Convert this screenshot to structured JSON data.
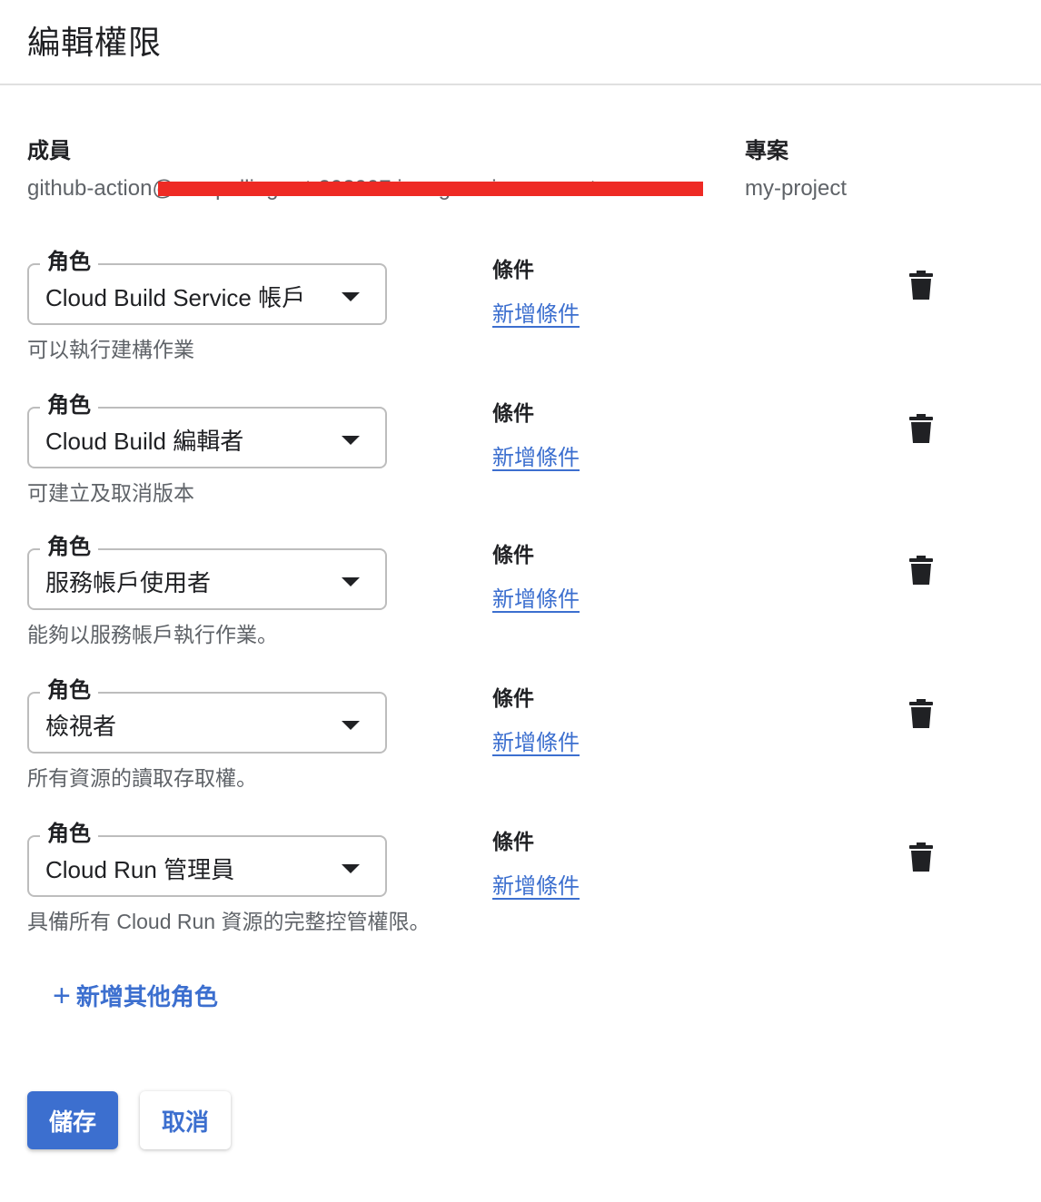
{
  "dialog": {
    "title": "編輯權限"
  },
  "member": {
    "label": "成員",
    "value": "github-action@compelling-art-292007.iam.gserviceaccount.com"
  },
  "project": {
    "label": "專案",
    "value": "my-project"
  },
  "roles": [
    {
      "legend": "角色",
      "value": "Cloud Build Service 帳戶",
      "description": "可以執行建構作業",
      "condition_label": "條件",
      "add_condition": "新增條件"
    },
    {
      "legend": "角色",
      "value": "Cloud Build 編輯者",
      "description": "可建立及取消版本",
      "condition_label": "條件",
      "add_condition": "新增條件"
    },
    {
      "legend": "角色",
      "value": "服務帳戶使用者",
      "description": "能夠以服務帳戶執行作業。",
      "condition_label": "條件",
      "add_condition": "新增條件"
    },
    {
      "legend": "角色",
      "value": "檢視者",
      "description": "所有資源的讀取存取權。",
      "condition_label": "條件",
      "add_condition": "新增條件"
    },
    {
      "legend": "角色",
      "value": "Cloud Run 管理員",
      "description": "具備所有 Cloud Run 資源的完整控管權限。",
      "condition_label": "條件",
      "add_condition": "新增條件"
    }
  ],
  "add_role": {
    "label": "新增其他角色"
  },
  "actions": {
    "save": "儲存",
    "cancel": "取消"
  },
  "colors": {
    "accent": "#3c6fcf",
    "redaction": "#ee2a24"
  }
}
